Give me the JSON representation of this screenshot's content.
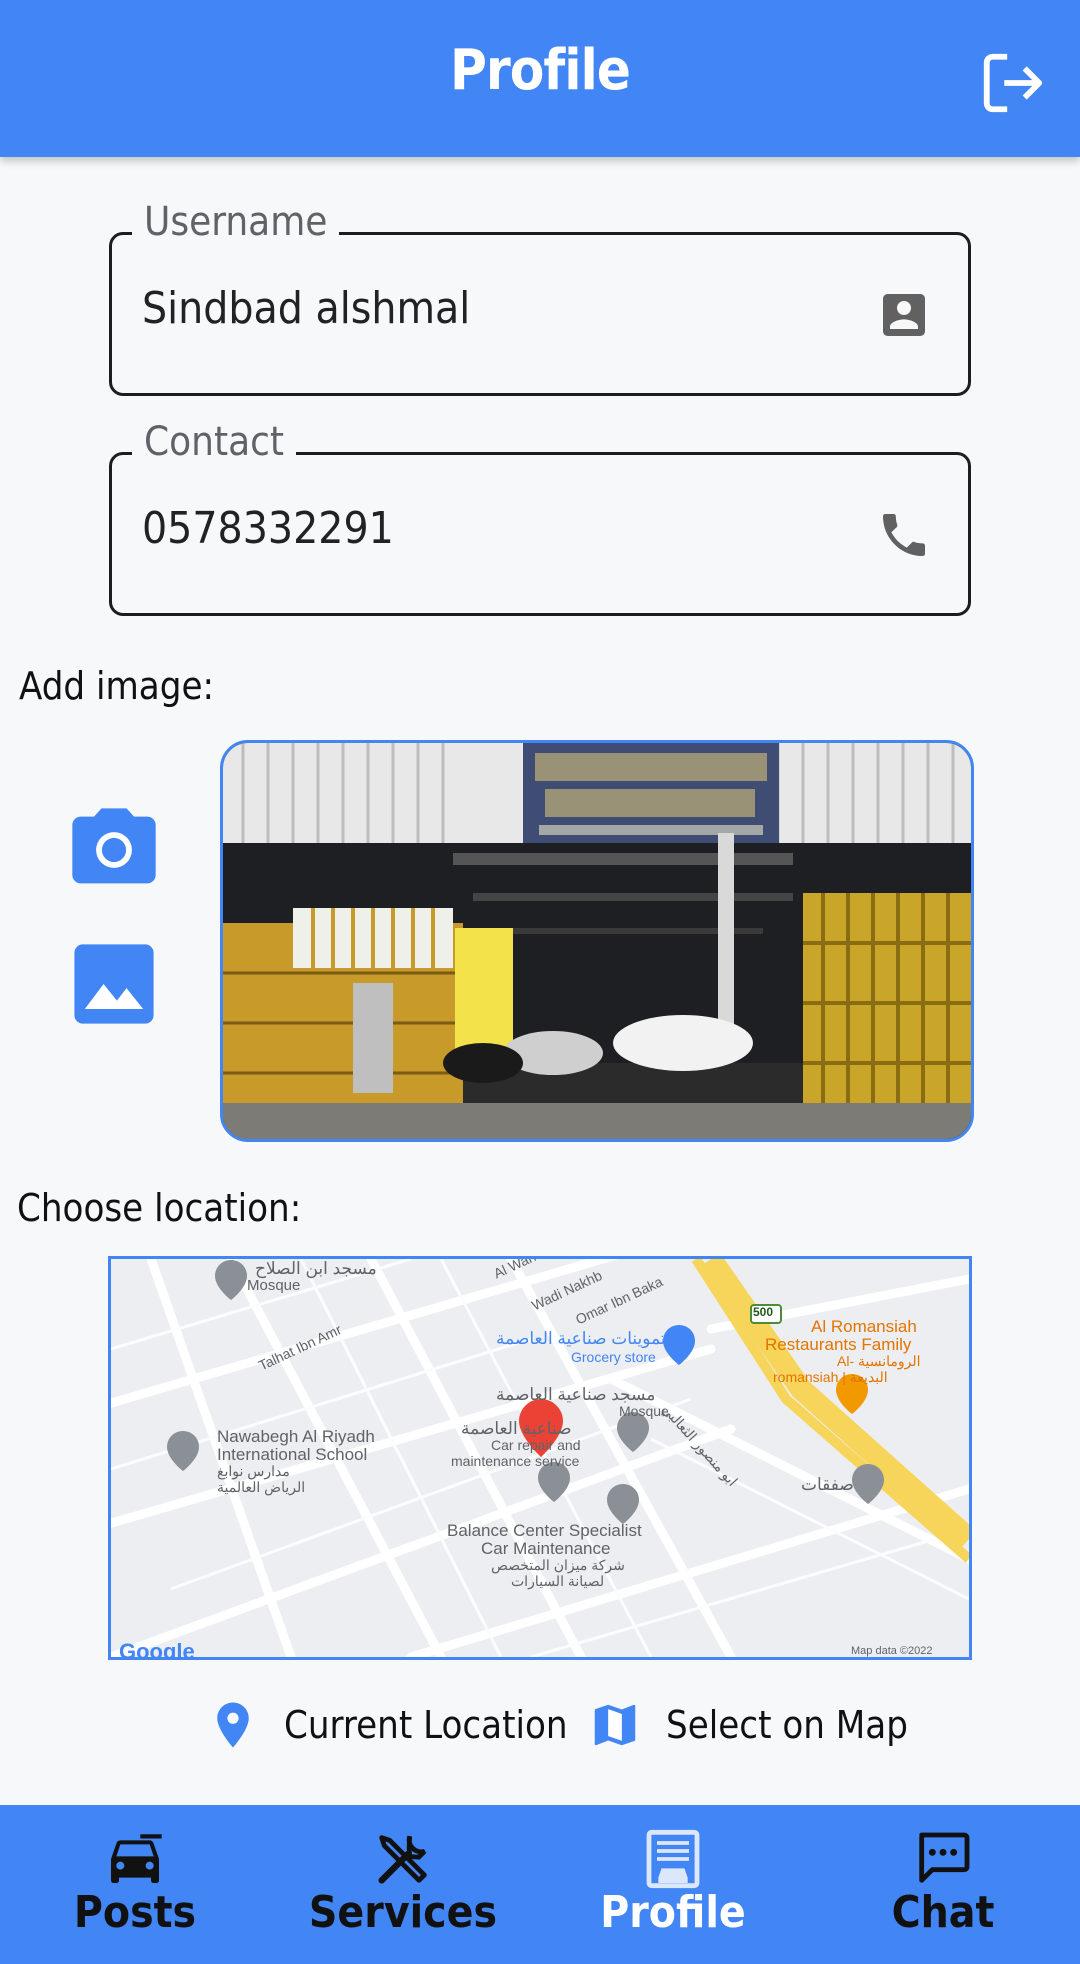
{
  "appbar": {
    "title": "Profile",
    "logout_icon": "logout-icon"
  },
  "form": {
    "username": {
      "label": "Username",
      "value": "Sindbad alshmal",
      "icon": "account-box-icon"
    },
    "contact": {
      "label": "Contact",
      "value": "0578332291",
      "icon": "phone-icon"
    }
  },
  "image_section": {
    "label": "Add image:",
    "camera_icon": "camera-icon",
    "gallery_icon": "image-gallery-icon"
  },
  "location_section": {
    "label": "Choose location:"
  },
  "map": {
    "labels": {
      "mosque1": "مسجد ابن الصلاح",
      "mosque1_en": "Mosque",
      "wahab": "Al Wahab",
      "wadi": "Wadi Nakhb",
      "omar": "Omar Ibn Baka",
      "talhat": "Talhat Ibn Amr",
      "grocery_ar": "تموينات صناعية العاصمة",
      "grocery_en": "Grocery store",
      "romansiah1": "Al Romansiah",
      "romansiah2": "Restaurants Family",
      "romansiah3": "Al- الرومانسية",
      "romansiah4": "romansiah | البديعة",
      "mosque2_ar": "مسجد صناعية العاصمة",
      "mosque2_en": "Mosque",
      "sanaiya": "صناعية العاصمة",
      "car_repair1": "Car repair and",
      "car_repair2": "maintenance service",
      "nawabegh1": "Nawabegh Al Riyadh",
      "nawabegh2": "International School",
      "nawabegh3": "مدارس نوابغ",
      "nawabegh4": "الرياض العالمية",
      "abu": "ابو منصور الثعالبي",
      "safaqat": "صفقات",
      "balance1": "Balance Center Specialist",
      "balance2": "Car Maintenance",
      "balance3": "شركة ميزان المتخصص",
      "balance4": "لصيانة السيارات",
      "road500": "500",
      "google": "Google",
      "mapdata": "Map data ©2022"
    }
  },
  "location_buttons": {
    "current": {
      "label": "Current Location",
      "icon": "location-pin-icon"
    },
    "select": {
      "label": "Select on Map",
      "icon": "map-icon"
    }
  },
  "bottom_nav": {
    "tabs": [
      {
        "label": "Posts",
        "icon": "car-icon"
      },
      {
        "label": "Services",
        "icon": "tools-icon"
      },
      {
        "label": "Profile",
        "icon": "garage-icon"
      },
      {
        "label": "Chat",
        "icon": "chat-icon"
      }
    ]
  },
  "colors": {
    "primary": "#4285f4",
    "background": "#f6f8fa",
    "text": "#111111"
  }
}
